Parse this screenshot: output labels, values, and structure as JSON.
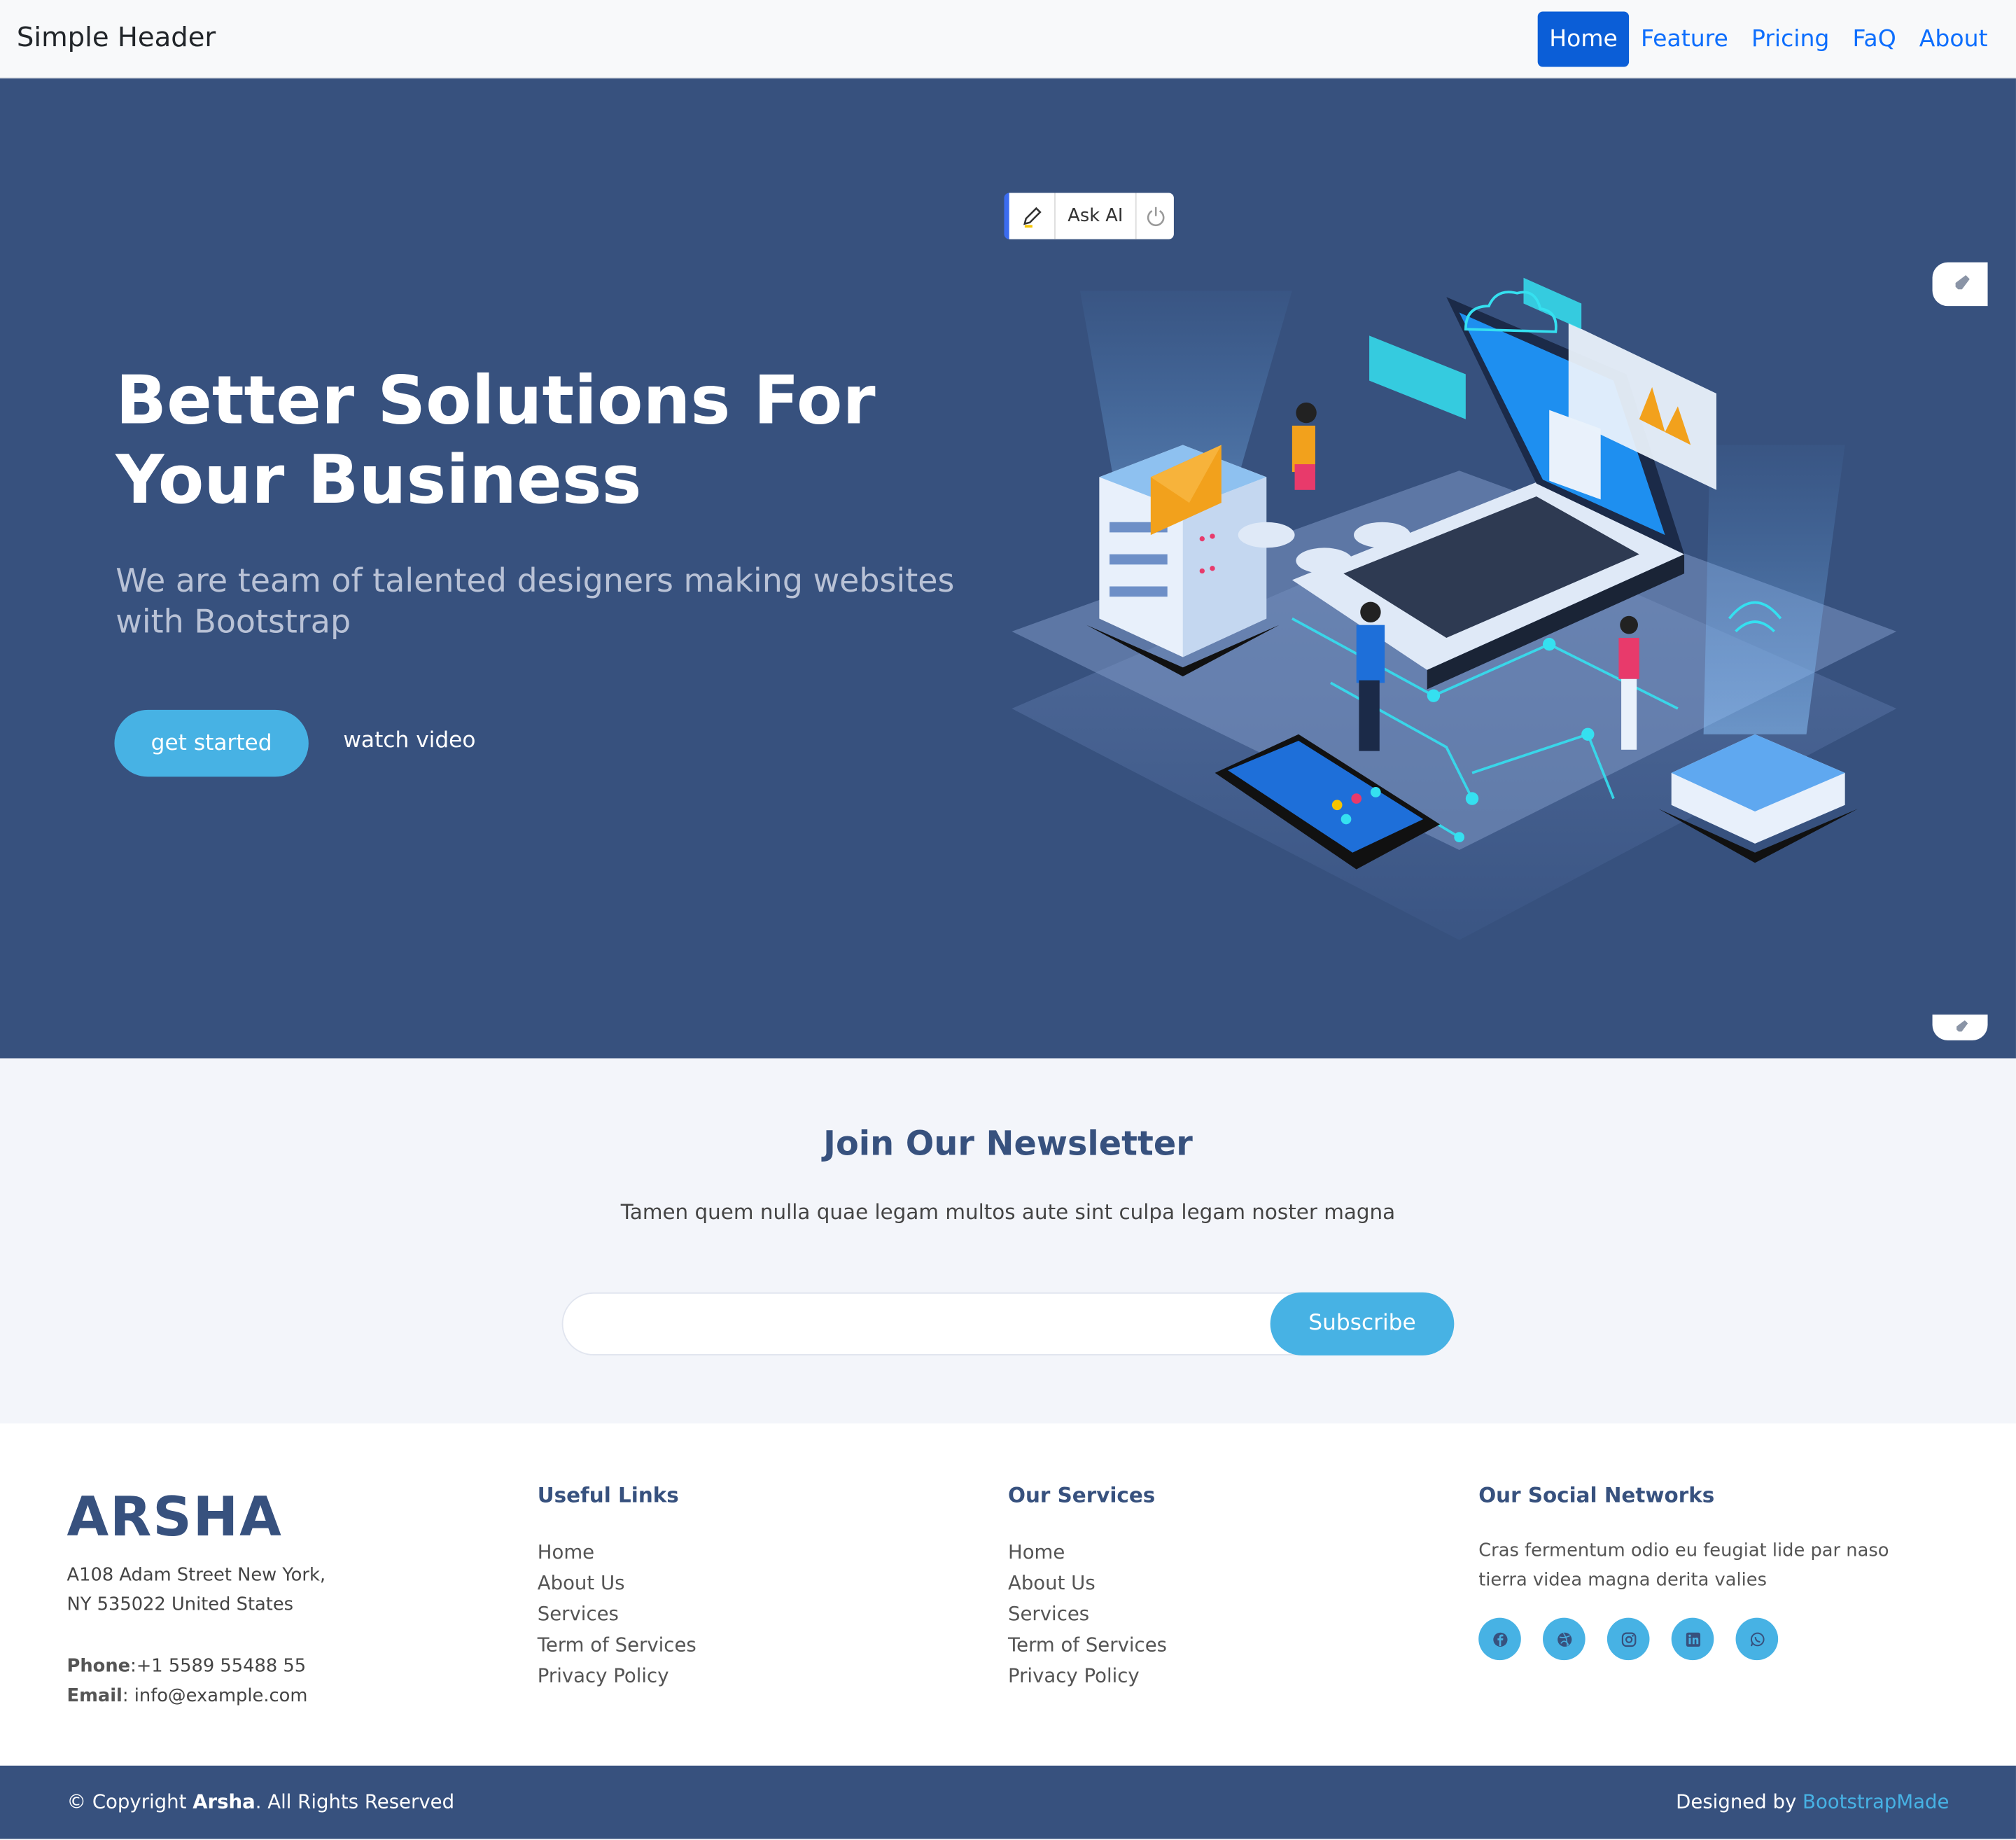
{
  "header": {
    "brand": "Simple Header",
    "nav": [
      "Home",
      "Feature",
      "Pricing",
      "FaQ",
      "About"
    ],
    "active": "Home"
  },
  "hero": {
    "title": "Better Solutions For Your Business",
    "subtitle": "We are team of talented designers making websites with Bootstrap",
    "cta_primary": "get started",
    "cta_secondary": "watch video",
    "askai_label": "Ask AI",
    "illustration": "isometric-laptop-servers-illustration"
  },
  "newsletter": {
    "title": "Join Our Newsletter",
    "text": "Tamen quem nulla quae legam multos aute sint culpa legam noster magna",
    "email_value": "",
    "subscribe_label": "Subscribe"
  },
  "footer": {
    "logo": "ARSHA",
    "address_line1": "A108 Adam Street New York,",
    "address_line2": "NY 535022 United States",
    "phone_label": "Phone",
    "phone": ":+1 5589 55488 55",
    "email_label": "Email",
    "email": ": info@example.com",
    "useful_links_title": "Useful Links",
    "useful_links": [
      "Home",
      "About Us",
      "Services",
      "Term of Services",
      "Privacy Policy"
    ],
    "services_title": "Our Services",
    "services": [
      "Home",
      "About Us",
      "Services",
      "Term of Services",
      "Privacy Policy"
    ],
    "social_title": "Our Social Networks",
    "social_text": "Cras fermentum odio eu feugiat lide par naso tierra videa magna derita valies",
    "social_icons": [
      "facebook-icon",
      "dribbble-icon",
      "instagram-icon",
      "linkedin-icon",
      "whatsapp-icon"
    ],
    "copyright_prefix": "© Copyright ",
    "copyright_brand": "Arsha",
    "copyright_suffix": ". All Rights Reserved",
    "designed_by": "Designed by ",
    "designer": "BootstrapMade"
  },
  "colors": {
    "hero_bg": "#37517e",
    "accent": "#47b2e4",
    "nav_active": "#0b5ed7",
    "link": "#0d6efd"
  }
}
